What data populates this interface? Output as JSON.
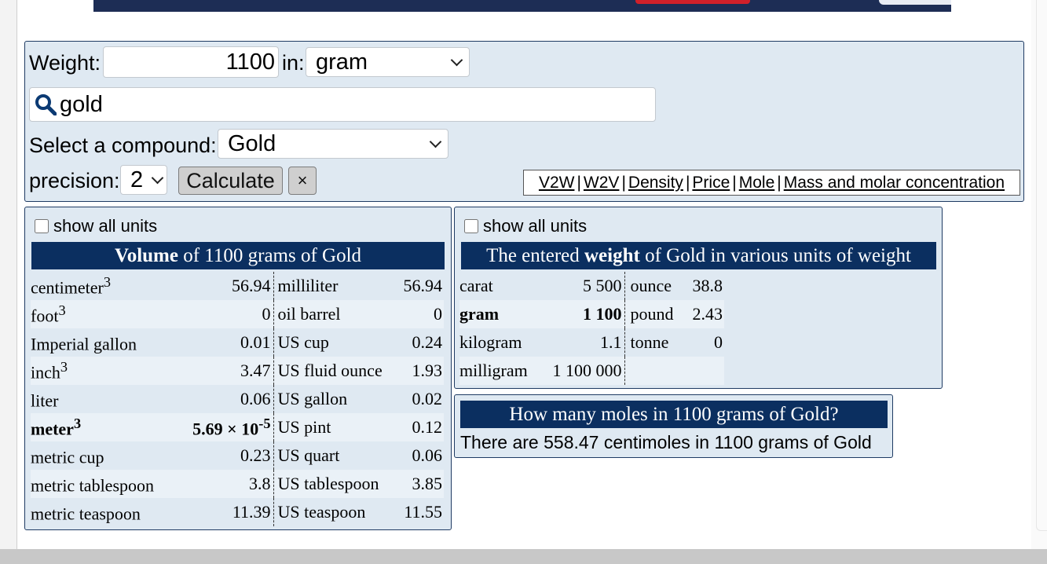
{
  "form": {
    "weight_label": "Weight:",
    "weight_value": "1100",
    "in_label": "in:",
    "unit_selected": "gram",
    "search_value": "gold",
    "compound_label": "Select a compound:",
    "compound_selected": "Gold",
    "precision_label": "precision:",
    "precision_selected": "2",
    "calculate_label": "Calculate",
    "clear_label": "×"
  },
  "links": [
    "V2W",
    "W2V",
    "Density",
    "Price",
    "Mole",
    "Mass and molar concentration"
  ],
  "links_separator": "|",
  "volume": {
    "show_all": "show all units",
    "header_bold": "Volume",
    "header_rest": " of 1100 grams of Gold",
    "rows": [
      {
        "u1": "centimeter",
        "sup1": "3",
        "v1": "56.94",
        "u2": "milliliter",
        "v2": "56.94"
      },
      {
        "u1": "foot",
        "sup1": "3",
        "v1": "0",
        "u2": "oil barrel",
        "v2": "0"
      },
      {
        "u1": "Imperial gallon",
        "sup1": "",
        "v1": "0.01",
        "u2": "US cup",
        "v2": "0.24"
      },
      {
        "u1": "inch",
        "sup1": "3",
        "v1": "3.47",
        "u2": "US fluid ounce",
        "v2": "1.93"
      },
      {
        "u1": "liter",
        "sup1": "",
        "v1": "0.06",
        "u2": "US gallon",
        "v2": "0.02"
      },
      {
        "u1": "meter",
        "sup1": "3",
        "v1": "5.69 × 10",
        "v1sup": "-5",
        "u2": "US pint",
        "v2": "0.12"
      },
      {
        "u1": "metric cup",
        "sup1": "",
        "v1": "0.23",
        "u2": "US quart",
        "v2": "0.06"
      },
      {
        "u1": "metric tablespoon",
        "sup1": "",
        "v1": "3.8",
        "u2": "US tablespoon",
        "v2": "3.85"
      },
      {
        "u1": "metric teaspoon",
        "sup1": "",
        "v1": "11.39",
        "u2": "US teaspoon",
        "v2": "11.55"
      }
    ]
  },
  "weight": {
    "show_all": "show all units",
    "header_pre": "The entered ",
    "header_bold": "weight",
    "header_rest": " of Gold in various units of weight",
    "rows": [
      {
        "u1": "carat",
        "v1": "5 500",
        "u2": "ounce",
        "v2": "38.8"
      },
      {
        "u1": "gram",
        "v1": "1 100",
        "u2": "pound",
        "v2": "2.43"
      },
      {
        "u1": "kilogram",
        "v1": "1.1",
        "u2": "tonne",
        "v2": "0"
      },
      {
        "u1": "milligram",
        "v1": "1 100 000",
        "u2": "",
        "v2": ""
      }
    ]
  },
  "moles": {
    "header": "How many moles in 1100 grams of Gold?",
    "text": "There are 558.47 centimoles in 1100 grams of Gold"
  }
}
